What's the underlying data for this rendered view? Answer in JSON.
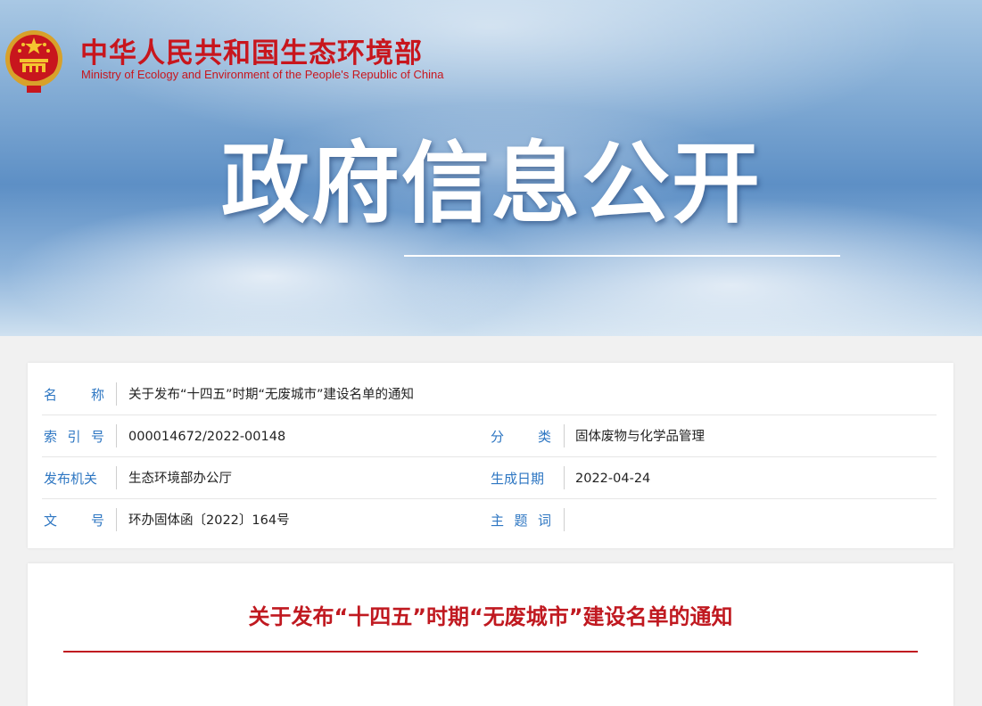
{
  "header": {
    "org_name_cn": "中华人民共和国生态环境部",
    "org_name_en": "Ministry of Ecology and Environment of the People's Republic of China",
    "section_title": "政府信息公开",
    "brand_color": "#c8161d"
  },
  "info": {
    "name_label": "名称",
    "name_value": "关于发布“十四五”时期“无废城市”建设名单的通知",
    "index_label": "索引号",
    "index_value": "000014672/2022-00148",
    "category_label": "分类",
    "category_value": "固体废物与化学品管理",
    "issuer_label": "发布机关",
    "issuer_value": "生态环境部办公厅",
    "date_label": "生成日期",
    "date_value": "2022-04-24",
    "doc_no_label": "文号",
    "doc_no_value": "环办固体函〔2022〕164号",
    "keywords_label": "主题词",
    "keywords_value": ""
  },
  "document": {
    "title": "关于发布“十四五”时期“无废城市”建设名单的通知",
    "title_color": "#c01920"
  }
}
